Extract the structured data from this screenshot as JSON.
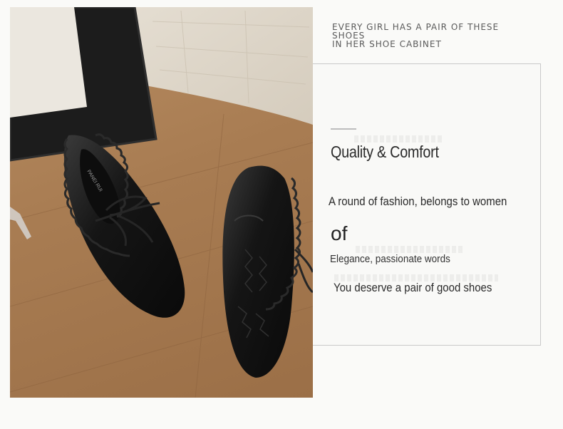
{
  "tagline": {
    "line1": "EVERY GIRL HAS A PAIR OF THESE",
    "line2": "SHOES",
    "line3": "IN HER SHOE CABINET"
  },
  "card": {
    "title": "Quality & Comfort",
    "line1": "A round of fashion, belongs to women",
    "line_of": "of",
    "line2": "Elegance, passionate words",
    "line3": "You deserve a pair of good shoes"
  },
  "photo": {
    "subject": "black ruffled flat shoes",
    "insole_brand": "PANEI RUI"
  },
  "colors": {
    "background": "#fafaf8",
    "floor": "#a87c52",
    "shoe": "#141414",
    "card_border": "#c9c9c9"
  }
}
